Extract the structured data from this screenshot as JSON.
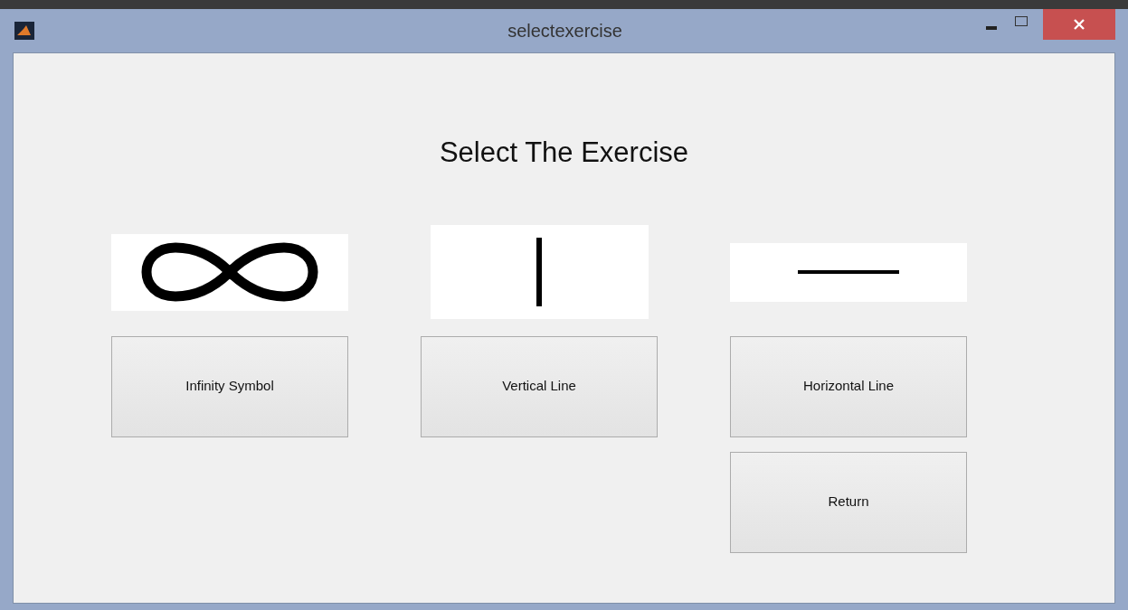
{
  "window": {
    "title": "selectexercise"
  },
  "heading": "Select The Exercise",
  "exercises": [
    {
      "kind": "infinity",
      "label": "Infinity Symbol"
    },
    {
      "kind": "vertical",
      "label": "Vertical Line"
    },
    {
      "kind": "horizontal",
      "label": "Horizontal Line"
    }
  ],
  "return_button": "Return"
}
